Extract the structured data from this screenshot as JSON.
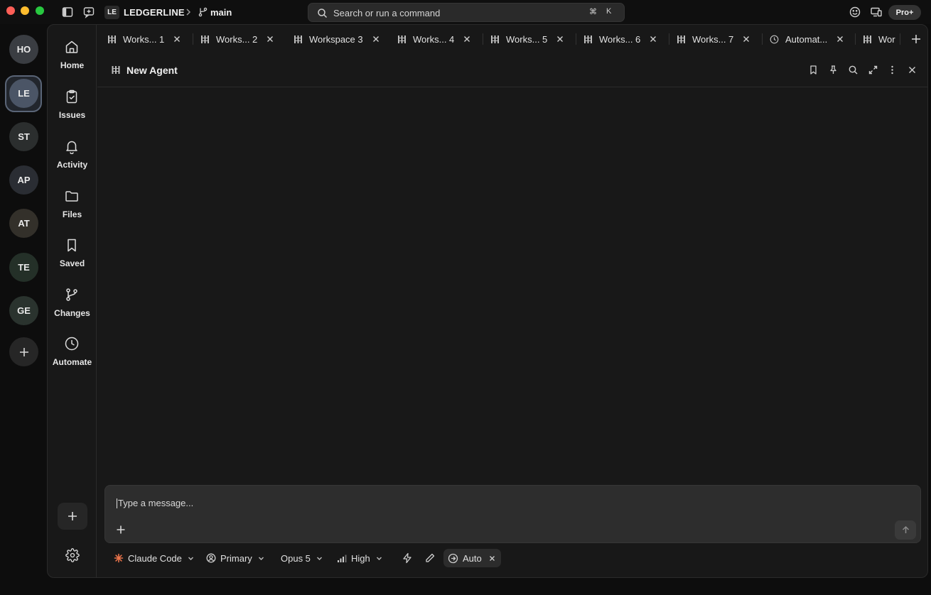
{
  "titlebar": {
    "workspace_badge": "LE",
    "workspace_name": "LEDGERLINE",
    "branch": "main",
    "search_placeholder": "Search or run a command",
    "shortcut_symbol": "⌘",
    "shortcut_key": "K",
    "plan_label": "Pro+"
  },
  "workspaces": [
    {
      "initials": "HO",
      "color": "#3a3d42"
    },
    {
      "initials": "LE",
      "color": "#4b5566",
      "active": true
    },
    {
      "initials": "ST",
      "color": "#2b2e2e"
    },
    {
      "initials": "AP",
      "color": "#2a2d33"
    },
    {
      "initials": "AT",
      "color": "#33302a"
    },
    {
      "initials": "TE",
      "color": "#243028"
    },
    {
      "initials": "GE",
      "color": "#2a332e"
    }
  ],
  "nav": [
    {
      "label": "Home",
      "icon": "home-icon"
    },
    {
      "label": "Issues",
      "icon": "clipboard-check-icon"
    },
    {
      "label": "Activity",
      "icon": "bell-icon"
    },
    {
      "label": "Files",
      "icon": "folder-icon"
    },
    {
      "label": "Saved",
      "icon": "bookmark-icon"
    },
    {
      "label": "Changes",
      "icon": "git-branch-icon"
    },
    {
      "label": "Automate",
      "icon": "clock-icon"
    }
  ],
  "tabs": [
    {
      "label": "Works... 1",
      "icon": "grid-icon"
    },
    {
      "label": "Works... 2",
      "icon": "grid-icon"
    },
    {
      "label": "Workspace 3",
      "icon": "grid-icon",
      "active": true
    },
    {
      "label": "Works... 4",
      "icon": "grid-icon"
    },
    {
      "label": "Works... 5",
      "icon": "grid-icon"
    },
    {
      "label": "Works... 6",
      "icon": "grid-icon"
    },
    {
      "label": "Works... 7",
      "icon": "grid-icon"
    },
    {
      "label": "Automat...",
      "icon": "clock-icon"
    },
    {
      "label": "Wor",
      "icon": "grid-icon"
    }
  ],
  "agent": {
    "title": "New Agent"
  },
  "composer": {
    "placeholder": "Type a message..."
  },
  "toolbar": {
    "agent_label": "Claude Code",
    "profile_label": "Primary",
    "model_label": "Opus 5",
    "effort_label": "High",
    "mode_label": "Auto"
  },
  "colors": {
    "accent_orange": "#e8734a",
    "background": "#181818",
    "active_ring": "#5a6577"
  }
}
